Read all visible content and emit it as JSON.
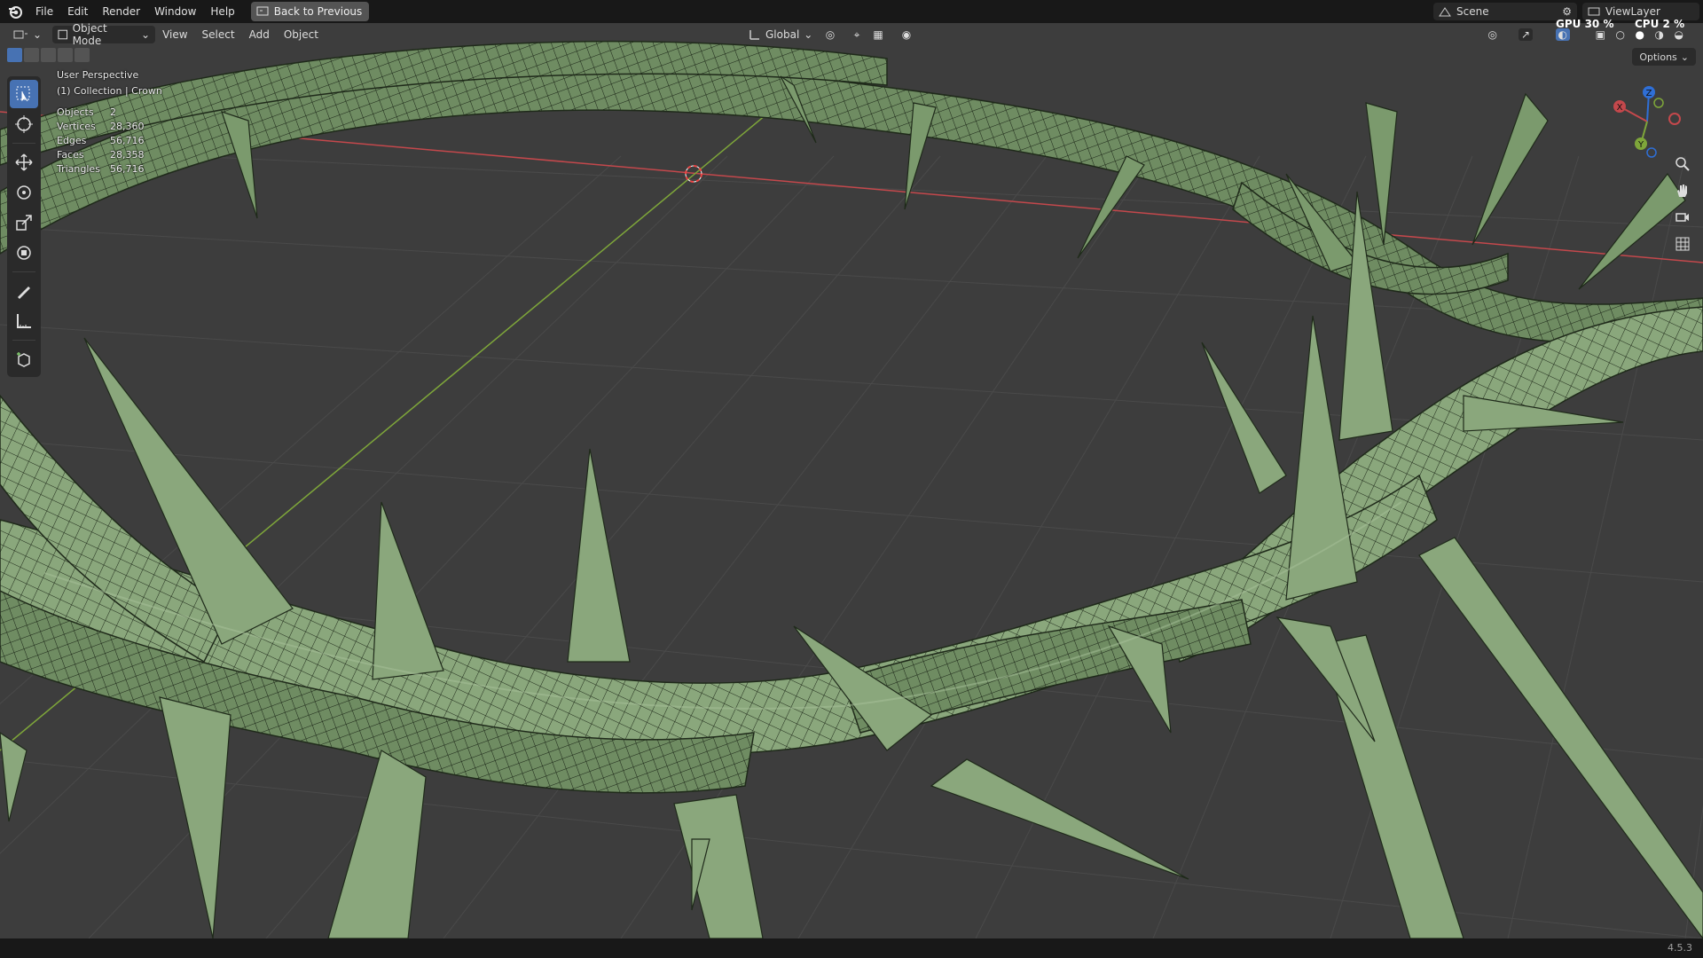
{
  "menu": {
    "items": [
      "File",
      "Edit",
      "Render",
      "Window",
      "Help"
    ],
    "back_button": "Back to Previous"
  },
  "top_right": {
    "scene": "Scene",
    "view_layer": "ViewLayer",
    "gpu_label": "GPU",
    "gpu_value": "30 %",
    "cpu_label": "CPU",
    "cpu_value": "2 %"
  },
  "viewport_header": {
    "mode": "Object Mode",
    "menus": [
      "View",
      "Select",
      "Add",
      "Object"
    ],
    "orientation": "Global",
    "options": "Options"
  },
  "overlay": {
    "perspective": "User Perspective",
    "collection": "(1) Collection | Crown",
    "stats": [
      {
        "label": "Objects",
        "value": "2"
      },
      {
        "label": "Vertices",
        "value": "28,360"
      },
      {
        "label": "Edges",
        "value": "56,716"
      },
      {
        "label": "Faces",
        "value": "28,358"
      },
      {
        "label": "Triangles",
        "value": "56,716"
      }
    ]
  },
  "gizmo": {
    "x": "X",
    "y": "Y",
    "z": "Z"
  },
  "status": {
    "version": "4.5.3"
  },
  "colors": {
    "viewport_bg": "#3d3d3d",
    "mesh_fill": "#8aa77c",
    "x_axis": "#c4484c",
    "y_axis": "#7ea63a",
    "accent": "#4772b3"
  }
}
